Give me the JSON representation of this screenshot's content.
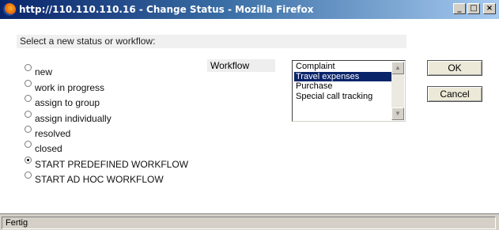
{
  "window": {
    "title": "http://110.110.110.16 - Change Status - Mozilla Firefox",
    "minimize_glyph": "_",
    "maximize_glyph": "□",
    "close_glyph": "×"
  },
  "prompt": "Select a new status or workflow:",
  "statuses": [
    {
      "label": "new",
      "checked": false
    },
    {
      "label": "work in progress",
      "checked": false
    },
    {
      "label": "assign to group",
      "checked": false
    },
    {
      "label": "assign individually",
      "checked": false
    },
    {
      "label": "resolved",
      "checked": false
    },
    {
      "label": "closed",
      "checked": false
    },
    {
      "label": "START PREDEFINED WORKFLOW",
      "checked": true
    },
    {
      "label": "START AD HOC WORKFLOW",
      "checked": false
    }
  ],
  "workflow": {
    "label": "Workflow",
    "options": [
      "Complaint",
      "Travel expenses",
      "Purchase",
      "Special call tracking"
    ],
    "selected_index": 1,
    "scroll_up_glyph": "▲",
    "scroll_down_glyph": "▼"
  },
  "buttons": {
    "ok": "OK",
    "cancel": "Cancel"
  },
  "status_bar": "Fertig",
  "colors": {
    "titlebar_start": "#0a246a",
    "titlebar_end": "#a6caf0",
    "selection": "#0a246a"
  }
}
